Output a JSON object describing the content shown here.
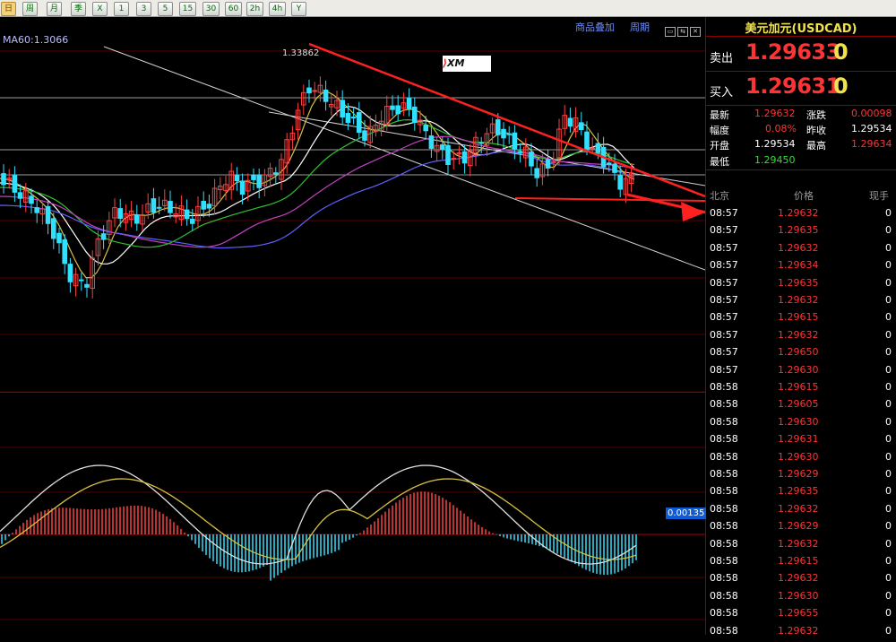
{
  "toolbar": {
    "buttons": [
      {
        "label": "日",
        "active": true
      },
      {
        "label": "周",
        "active": false
      },
      {
        "label": "月",
        "active": false
      },
      {
        "label": "季",
        "active": false
      },
      {
        "label": "X",
        "active": false
      },
      {
        "label": "1",
        "active": false
      },
      {
        "label": "3",
        "active": false
      },
      {
        "label": "5",
        "active": false
      },
      {
        "label": "15",
        "active": false
      },
      {
        "label": "30",
        "active": false
      },
      {
        "label": "60",
        "active": false
      },
      {
        "label": "2h",
        "active": false
      },
      {
        "label": "4h",
        "active": false
      },
      {
        "label": "Y",
        "active": false
      }
    ]
  },
  "chart": {
    "ma_label": "MA60:1.3066",
    "overlay_link": "商品叠加",
    "period_link": "周期",
    "peak_label": "1.33862",
    "macd_value": "0.00135",
    "logo_text": "XM"
  },
  "chart_data": {
    "type": "candlestick",
    "peak_high": 1.33862,
    "ma60": 1.3066,
    "macd_current": 0.00135
  },
  "quote": {
    "title": "美元加元(USDCAD)",
    "sell_label": "卖出",
    "sell_price": "1.29633",
    "sell_tail": "0",
    "buy_label": "买入",
    "buy_price": "1.29631",
    "buy_tail": "0",
    "stats": {
      "latest_label": "最新",
      "latest": "1.29632",
      "change_label": "涨跌",
      "change": "0.00098",
      "amp_label": "幅度",
      "amp": "0.08%",
      "prev_label": "昨收",
      "prev": "1.29534",
      "open_label": "开盘",
      "open": "1.29534",
      "high_label": "最高",
      "high": "1.29634",
      "low_label": "最低",
      "low": "1.29450"
    },
    "tick_headers": {
      "time": "北京",
      "price": "价格",
      "volume": "现手"
    },
    "ticks": [
      {
        "time": "08:57",
        "price": "1.29632",
        "vol": "0"
      },
      {
        "time": "08:57",
        "price": "1.29635",
        "vol": "0"
      },
      {
        "time": "08:57",
        "price": "1.29632",
        "vol": "0"
      },
      {
        "time": "08:57",
        "price": "1.29634",
        "vol": "0"
      },
      {
        "time": "08:57",
        "price": "1.29635",
        "vol": "0"
      },
      {
        "time": "08:57",
        "price": "1.29632",
        "vol": "0"
      },
      {
        "time": "08:57",
        "price": "1.29615",
        "vol": "0"
      },
      {
        "time": "08:57",
        "price": "1.29632",
        "vol": "0"
      },
      {
        "time": "08:57",
        "price": "1.29650",
        "vol": "0"
      },
      {
        "time": "08:57",
        "price": "1.29630",
        "vol": "0"
      },
      {
        "time": "08:58",
        "price": "1.29615",
        "vol": "0"
      },
      {
        "time": "08:58",
        "price": "1.29605",
        "vol": "0"
      },
      {
        "time": "08:58",
        "price": "1.29630",
        "vol": "0"
      },
      {
        "time": "08:58",
        "price": "1.29631",
        "vol": "0"
      },
      {
        "time": "08:58",
        "price": "1.29630",
        "vol": "0"
      },
      {
        "time": "08:58",
        "price": "1.29629",
        "vol": "0"
      },
      {
        "time": "08:58",
        "price": "1.29635",
        "vol": "0"
      },
      {
        "time": "08:58",
        "price": "1.29632",
        "vol": "0"
      },
      {
        "time": "08:58",
        "price": "1.29629",
        "vol": "0"
      },
      {
        "time": "08:58",
        "price": "1.29632",
        "vol": "0"
      },
      {
        "time": "08:58",
        "price": "1.29615",
        "vol": "0"
      },
      {
        "time": "08:58",
        "price": "1.29632",
        "vol": "0"
      },
      {
        "time": "08:58",
        "price": "1.29630",
        "vol": "0"
      },
      {
        "time": "08:58",
        "price": "1.29655",
        "vol": "0"
      },
      {
        "time": "08:58",
        "price": "1.29632",
        "vol": "0"
      }
    ]
  }
}
